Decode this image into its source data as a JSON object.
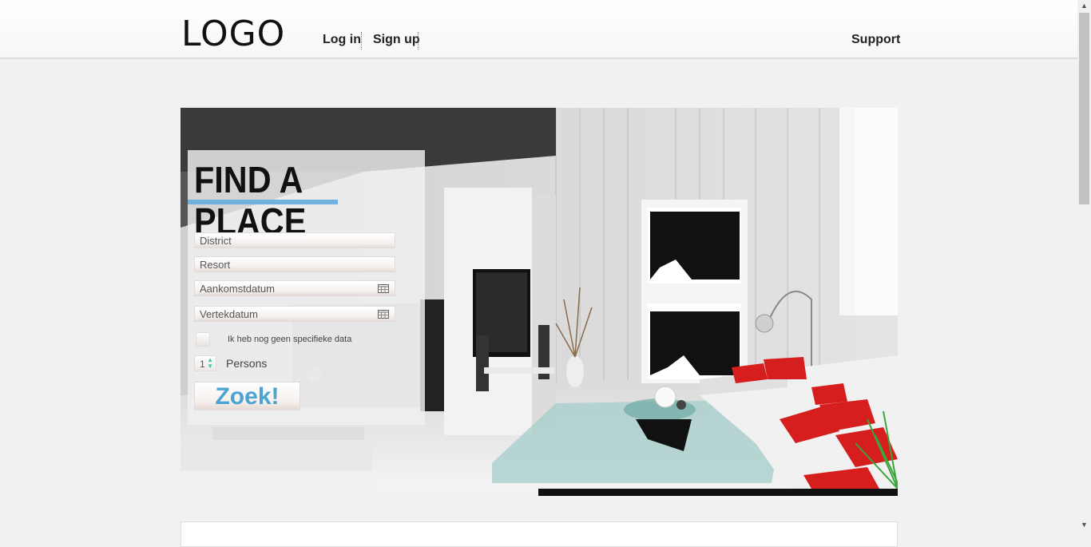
{
  "header": {
    "logo": "LOGO",
    "nav": {
      "login": "Log in",
      "signup": "Sign up",
      "support": "Support"
    }
  },
  "search": {
    "title": "FIND A PLACE",
    "district": "District",
    "resort": "Resort",
    "arrival": "Aankomstdatum",
    "departure": "Vertekdatum",
    "no_dates_label": "Ik heb nog geen specifieke data",
    "persons_value": "1",
    "persons_label": "Persons",
    "submit": "Zoek!"
  },
  "colors": {
    "accent": "#6fb1df",
    "button_text": "#4ba4d2",
    "sofa_red": "#d61e1e"
  },
  "icons": [
    "calendar-icon",
    "stepper-arrows-icon"
  ]
}
